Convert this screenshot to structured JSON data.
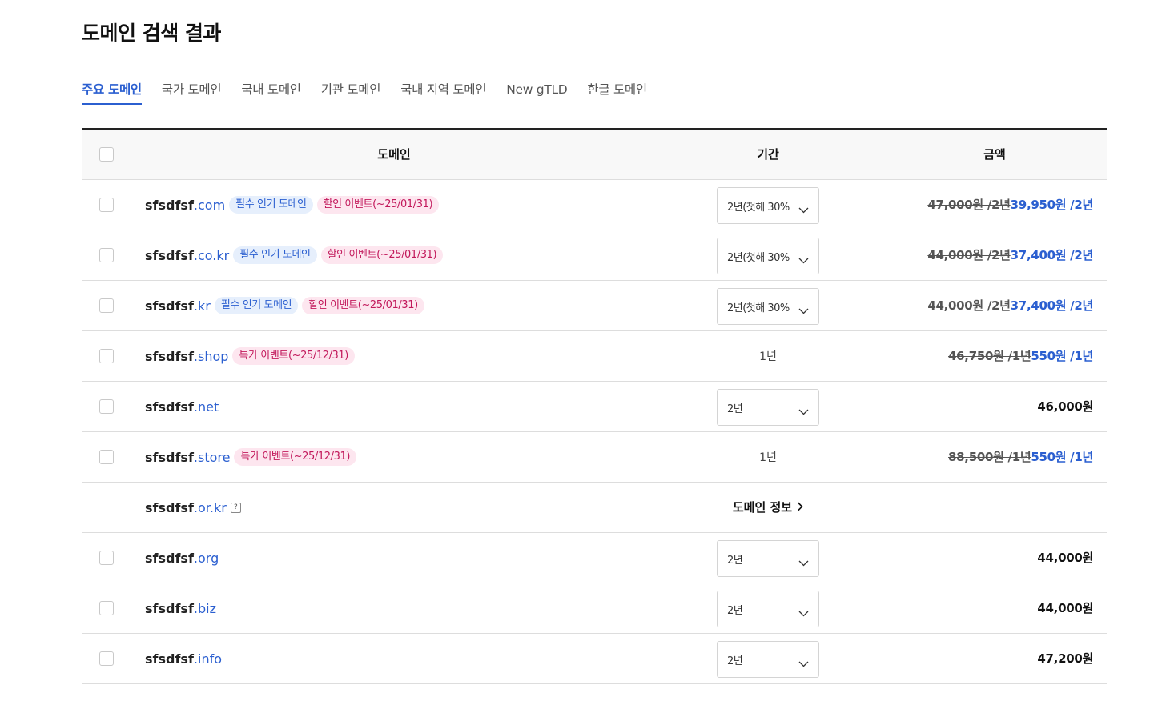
{
  "page": {
    "title": "도메인 검색 결과"
  },
  "tabs": [
    {
      "label": "주요 도메인",
      "active": true
    },
    {
      "label": "국가 도메인"
    },
    {
      "label": "국내 도메인"
    },
    {
      "label": "기관 도메인"
    },
    {
      "label": "국내 지역 도메인"
    },
    {
      "label": "New gTLD"
    },
    {
      "label": "한글 도메인"
    }
  ],
  "table": {
    "headers": {
      "domain": "도메인",
      "period": "기간",
      "price": "금액"
    },
    "rows": [
      {
        "name": "sfsdfsf",
        "tld": ".com",
        "badges": [
          {
            "text": "필수 인기 도메인",
            "color": "blue"
          },
          {
            "text": "할인 이벤트(~25/01/31)",
            "color": "pink"
          }
        ],
        "period": "2년(첫해 30%",
        "old_price": "47,000원 /2년",
        "price": "39,950원 /2년"
      },
      {
        "name": "sfsdfsf",
        "tld": ".co.kr",
        "badges": [
          {
            "text": "필수 인기 도메인",
            "color": "blue"
          },
          {
            "text": "할인 이벤트(~25/01/31)",
            "color": "pink"
          }
        ],
        "period": "2년(첫해 30%",
        "old_price": "44,000원 /2년",
        "price": "37,400원 /2년"
      },
      {
        "name": "sfsdfsf",
        "tld": ".kr",
        "badges": [
          {
            "text": "필수 인기 도메인",
            "color": "blue"
          },
          {
            "text": "할인 이벤트(~25/01/31)",
            "color": "pink"
          }
        ],
        "period": "2년(첫해 30%",
        "old_price": "44,000원 /2년",
        "price": "37,400원 /2년"
      },
      {
        "name": "sfsdfsf",
        "tld": ".shop",
        "badges": [
          {
            "text": "특가 이벤트(~25/12/31)",
            "color": "pink"
          }
        ],
        "period_text": "1년",
        "old_price": "46,750원 /1년",
        "price": "550원 /1년"
      },
      {
        "name": "sfsdfsf",
        "tld": ".net",
        "badges": [],
        "period": "2년",
        "price_plain": "46,000원"
      },
      {
        "name": "sfsdfsf",
        "tld": ".store",
        "badges": [
          {
            "text": "특가 이벤트(~25/12/31)",
            "color": "pink"
          }
        ],
        "period_text": "1년",
        "old_price": "88,500원 /1년",
        "price": "550원 /1년"
      },
      {
        "name": "sfsdfsf",
        "tld": ".or.kr",
        "help": "?",
        "info_link": "도메인 정보",
        "no_checkbox": true
      },
      {
        "name": "sfsdfsf",
        "tld": ".org",
        "badges": [],
        "period": "2년",
        "price_plain": "44,000원"
      },
      {
        "name": "sfsdfsf",
        "tld": ".biz",
        "badges": [],
        "period": "2년",
        "price_plain": "44,000원"
      },
      {
        "name": "sfsdfsf",
        "tld": ".info",
        "badges": [],
        "period": "2년",
        "price_plain": "47,200원"
      }
    ]
  }
}
